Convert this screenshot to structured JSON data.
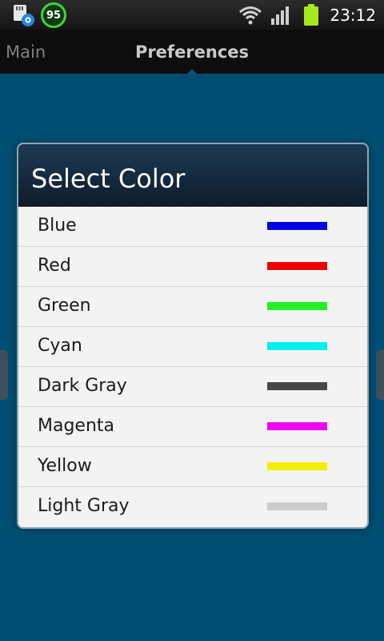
{
  "status_bar": {
    "notifications": [
      {
        "icon": "sd-card-settings-icon"
      },
      {
        "icon": "progress-badge-icon",
        "value": "95"
      }
    ],
    "wifi_icon": "wifi-icon",
    "signal_icon": "signal-strength-icon",
    "battery_icon": "battery-icon",
    "time": "23:12"
  },
  "tabs": {
    "main_label": "Main",
    "preferences_label": "Preferences",
    "active": "Preferences"
  },
  "dialog": {
    "title": "Select Color",
    "colors": [
      {
        "label": "Blue",
        "hex": "#0000e0"
      },
      {
        "label": "Red",
        "hex": "#ee0000"
      },
      {
        "label": "Green",
        "hex": "#22f022"
      },
      {
        "label": "Cyan",
        "hex": "#00f0f0"
      },
      {
        "label": "Dark Gray",
        "hex": "#474747"
      },
      {
        "label": "Magenta",
        "hex": "#f000f0"
      },
      {
        "label": "Yellow",
        "hex": "#f0f000"
      },
      {
        "label": "Light Gray",
        "hex": "#cccccc"
      }
    ]
  },
  "theme": {
    "background": "#004f73",
    "badge_ring": "#3fd23a",
    "battery": "#a8e61d"
  }
}
